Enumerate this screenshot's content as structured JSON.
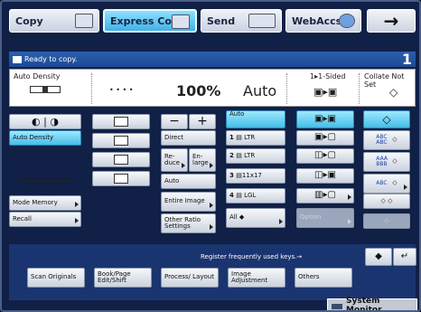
{
  "tabs": [
    {
      "label": "Copy",
      "icon": "copier-icon"
    },
    {
      "label": "Express Copy",
      "icon": "copier-icon"
    },
    {
      "label": "Send",
      "icon": "send-icon"
    },
    {
      "label": "WebAccss",
      "icon": "globe-icon"
    }
  ],
  "arrow_label": "→",
  "status": {
    "text": "Ready to copy.",
    "count": "1"
  },
  "mode": {
    "density_label": "Auto Density",
    "dots": "• • • •",
    "ratio": "100%",
    "paper": "Auto",
    "sided_label": "1▸1-Sided",
    "collate_label": "Collate Not Set"
  },
  "col1": {
    "auto_density": "Auto Density",
    "mode_memory": "Mode Memory",
    "recall": "Recall"
  },
  "col3": {
    "direct": "Direct",
    "reduce": "Re- duce",
    "enlarge": "En- large",
    "auto": "Auto",
    "entire": "Entire Image",
    "other_ratio": "Other Ratio Settings"
  },
  "col4": {
    "auto": "Auto",
    "ltr": "LTR",
    "ltr2": "LTR",
    "size11x17": "11x17",
    "lgl": "LGL",
    "all": "All"
  },
  "col5": {
    "option": "Option"
  },
  "collate": {
    "abc1": "ABC ABC",
    "abc2": "AAA BBB",
    "abc3": "ABC"
  },
  "register_text": "Register frequently used keys.→",
  "bottom": [
    {
      "label": "Scan Originals"
    },
    {
      "label": "Book/Page Edit/Shift"
    },
    {
      "label": "Process/ Layout"
    },
    {
      "label": "Image Adjustment"
    },
    {
      "label": "Others"
    }
  ],
  "system_monitor": "System Monitor",
  "colors": {
    "selected": "#47bde8",
    "panel": "#102046",
    "status": "#1d4a94"
  }
}
